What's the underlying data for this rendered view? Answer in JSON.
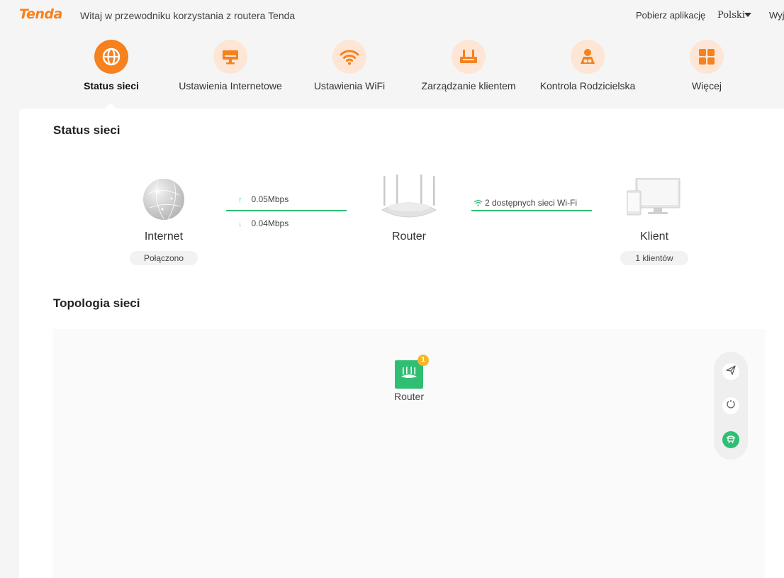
{
  "header": {
    "logo": "Tenda",
    "welcome": "Witaj w przewodniku korzystania z routera Tenda",
    "download_app": "Pobierz aplikację",
    "language": "Polski",
    "logout": "Wyj"
  },
  "nav": [
    {
      "label": "Status sieci",
      "icon": "globe-icon",
      "active": true
    },
    {
      "label": "Ustawienia Internetowe",
      "icon": "monitor-icon",
      "active": false
    },
    {
      "label": "Ustawienia WiFi",
      "icon": "wifi-icon",
      "active": false
    },
    {
      "label": "Zarządzanie klientem",
      "icon": "router-icon",
      "active": false
    },
    {
      "label": "Kontrola Rodzicielska",
      "icon": "parental-icon",
      "active": false
    },
    {
      "label": "Więcej",
      "icon": "grid-icon",
      "active": false
    }
  ],
  "status": {
    "title": "Status sieci",
    "internet_label": "Internet",
    "internet_status": "Połączono",
    "upload": "0.05Mbps",
    "download": "0.04Mbps",
    "router_label": "Router",
    "wifi_info": "2 dostępnych sieci Wi-Fi",
    "client_label": "Klient",
    "client_count": "1 klientów"
  },
  "topology": {
    "title": "Topologia sieci",
    "node_label": "Router",
    "node_badge": "1"
  },
  "colors": {
    "accent": "#f6811f",
    "accent_light": "#fde6d5",
    "green": "#2fbe72",
    "badge": "#f5b62a"
  }
}
